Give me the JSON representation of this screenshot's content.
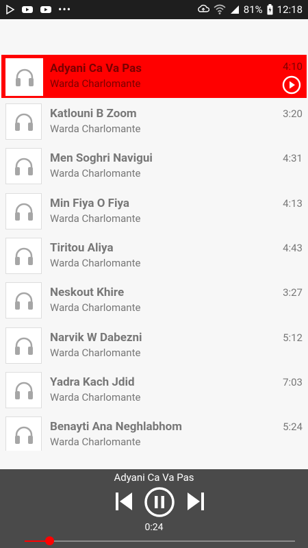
{
  "status_bar": {
    "battery": "81%",
    "time": "12:18",
    "icons": [
      "play-store-icon",
      "youtube-icon",
      "youtube-icon",
      "more-dots-icon",
      "sync-icon",
      "wifi-icon",
      "signal-icon",
      "battery-icon"
    ]
  },
  "songs": [
    {
      "title": "Adyani Ca Va Pas",
      "artist": "Warda Charlomante",
      "duration": "4:10",
      "active": true
    },
    {
      "title": "Katlouni B Zoom",
      "artist": "Warda Charlomante",
      "duration": "3:20"
    },
    {
      "title": "Men Soghri Navigui",
      "artist": "Warda Charlomante",
      "duration": "4:31"
    },
    {
      "title": "Min Fiya O Fiya",
      "artist": "Warda Charlomante",
      "duration": "4:13"
    },
    {
      "title": "Tiritou Aliya",
      "artist": "Warda Charlomante",
      "duration": "4:43"
    },
    {
      "title": "Neskout Khire",
      "artist": "Warda Charlomante",
      "duration": "3:27"
    },
    {
      "title": "Narvik W Dabezni",
      "artist": "Warda Charlomante",
      "duration": "5:12"
    },
    {
      "title": "Yadra Kach Jdid",
      "artist": "Warda Charlomante",
      "duration": "7:03"
    },
    {
      "title": "Benayti Ana Neghlabhom",
      "artist": "Warda Charlomante",
      "duration": "5:24"
    }
  ],
  "player": {
    "now_playing": "Adyani Ca Va Pas",
    "elapsed": "0:24",
    "progress_fraction": 0.09
  },
  "colors": {
    "accent": "#ff0000",
    "status_bar_bg": "#1e1e1e",
    "player_bg": "#4a4a4a",
    "text_gray": "#777777"
  }
}
